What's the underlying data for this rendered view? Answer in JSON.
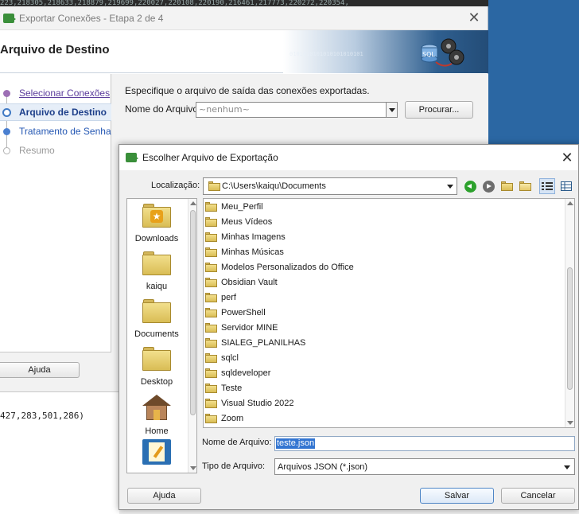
{
  "background": {
    "top_text": "223,218305,218633,218879,219699,220027,220108,220190,216461,217773,220272,220354,",
    "code_line": "427,283,501,286)"
  },
  "wizard": {
    "title": "Exportar Conexões - Etapa 2 de 4",
    "header_title": "Arquivo de Destino",
    "banner_bits": "0101010101010101010101",
    "steps": [
      {
        "label": "Selecionar Conexões",
        "state": "link"
      },
      {
        "label": "Arquivo de Destino",
        "state": "current"
      },
      {
        "label": "Tratamento de Senha",
        "state": "blue"
      },
      {
        "label": "Resumo",
        "state": "disabled"
      }
    ],
    "description": "Especifique o arquivo de saída das conexões exportadas.",
    "file_label": "Nome do Arquivo",
    "file_value": "~nenhum~",
    "browse_button": "Procurar...",
    "help_button": "Ajuda"
  },
  "chooser": {
    "title": "Escolher Arquivo de Exportação",
    "location_label": "Localização:",
    "location_value": "C:\\Users\\kaiqu\\Documents",
    "toolbar": [
      "back-icon",
      "forward-icon",
      "up-folder-icon",
      "new-folder-icon",
      "list-view-icon",
      "details-view-icon"
    ],
    "places": [
      "Downloads",
      "kaiqu",
      "Documents",
      "Desktop",
      "Home"
    ],
    "files": [
      "Meu_Perfil",
      "Meus Vídeos",
      "Minhas Imagens",
      "Minhas Músicas",
      "Modelos Personalizados do Office",
      "Obsidian Vault",
      "perf",
      "PowerShell",
      "Servidor MINE",
      "SIALEG_PLANILHAS",
      "sqlcl",
      "sqldeveloper",
      "Teste",
      "Visual Studio 2022",
      "Zoom"
    ],
    "file_name_label": "Nome de Arquivo:",
    "file_name_value": "teste.json",
    "file_type_label": "Tipo de Arquivo:",
    "file_type_value": "Arquivos JSON (*.json)",
    "help_button": "Ajuda",
    "save_button": "Salvar",
    "cancel_button": "Cancelar"
  }
}
